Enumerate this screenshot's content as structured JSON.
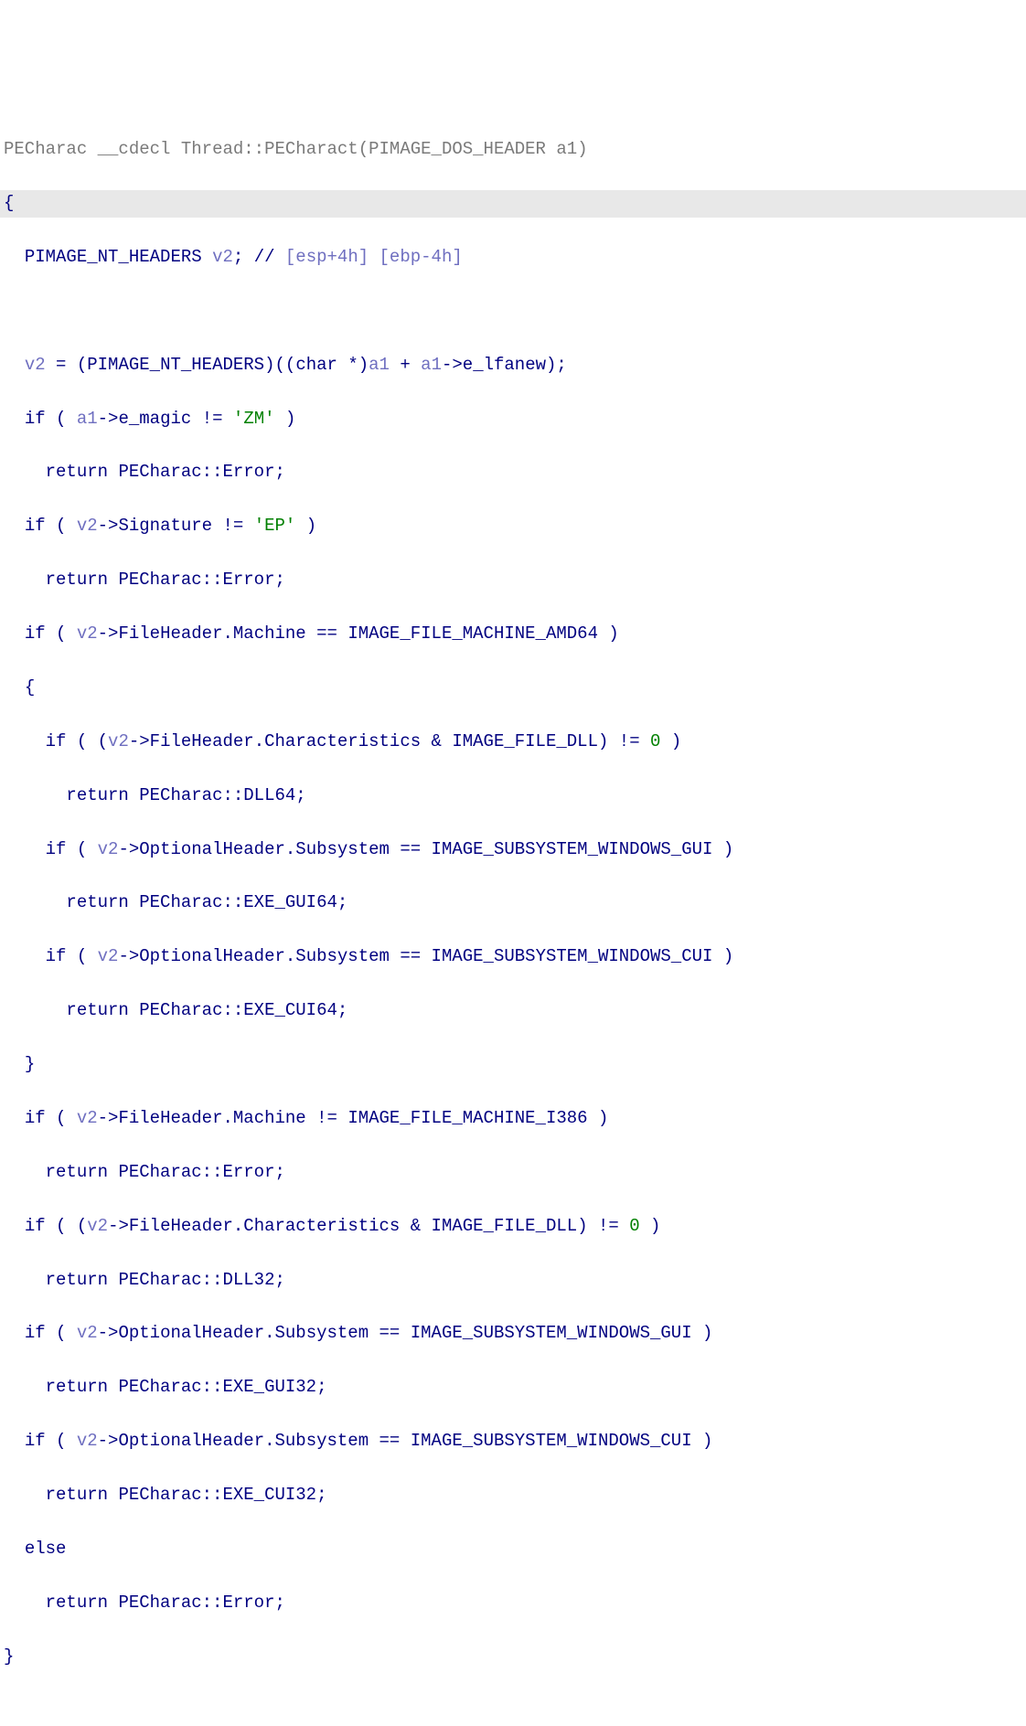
{
  "sig": {
    "ret": "PECharac",
    "conv": "__cdecl",
    "cls": "Thread",
    "fn": "PECharact",
    "argtype": "PIMAGE_DOS_HEADER",
    "argname": "a1"
  },
  "decl": {
    "type": "PIMAGE_NT_HEADERS",
    "name": "v2",
    "comment_slashes": "//",
    "reg_a": "[esp+4h]",
    "reg_b": "[ebp-4h]"
  },
  "tok": {
    "lbrace": "{",
    "rbrace": "}",
    "if": "if",
    "return": "return",
    "else": "else",
    "char_star": "char",
    "star": "*",
    "zero": "0",
    "ZM": "'ZM'",
    "EP": "'EP'",
    "ne": "!=",
    "eq": "==",
    "amp": "&",
    "plus": "+",
    "semi": ";",
    "lpar": "(",
    "rpar": ")",
    "lpar2": "((",
    "rpar2": "))",
    "v2": "v2",
    "a1": "a1",
    "e_lfanew": "e_lfanew",
    "e_magic": "e_magic",
    "Signature": "Signature",
    "FH_Machine": "FileHeader.Machine",
    "FH_Char": "FileHeader.Characteristics",
    "OH_Sub": "OptionalHeader.Subsystem",
    "dll": "IMAGE_FILE_DLL",
    "amd64": "IMAGE_FILE_MACHINE_AMD64",
    "i386": "IMAGE_FILE_MACHINE_I386",
    "sub_gui": "IMAGE_SUBSYSTEM_WINDOWS_GUI",
    "sub_cui": "IMAGE_SUBSYSTEM_WINDOWS_CUI",
    "err": "PECharac::Error",
    "dll64": "PECharac::DLL64",
    "exe_gui64": "PECharac::EXE_GUI64",
    "exe_cui64": "PECharac::EXE_CUI64",
    "dll32": "PECharac::DLL32",
    "exe_gui32": "PECharac::EXE_GUI32",
    "exe_cui32": "PECharac::EXE_CUI32"
  }
}
